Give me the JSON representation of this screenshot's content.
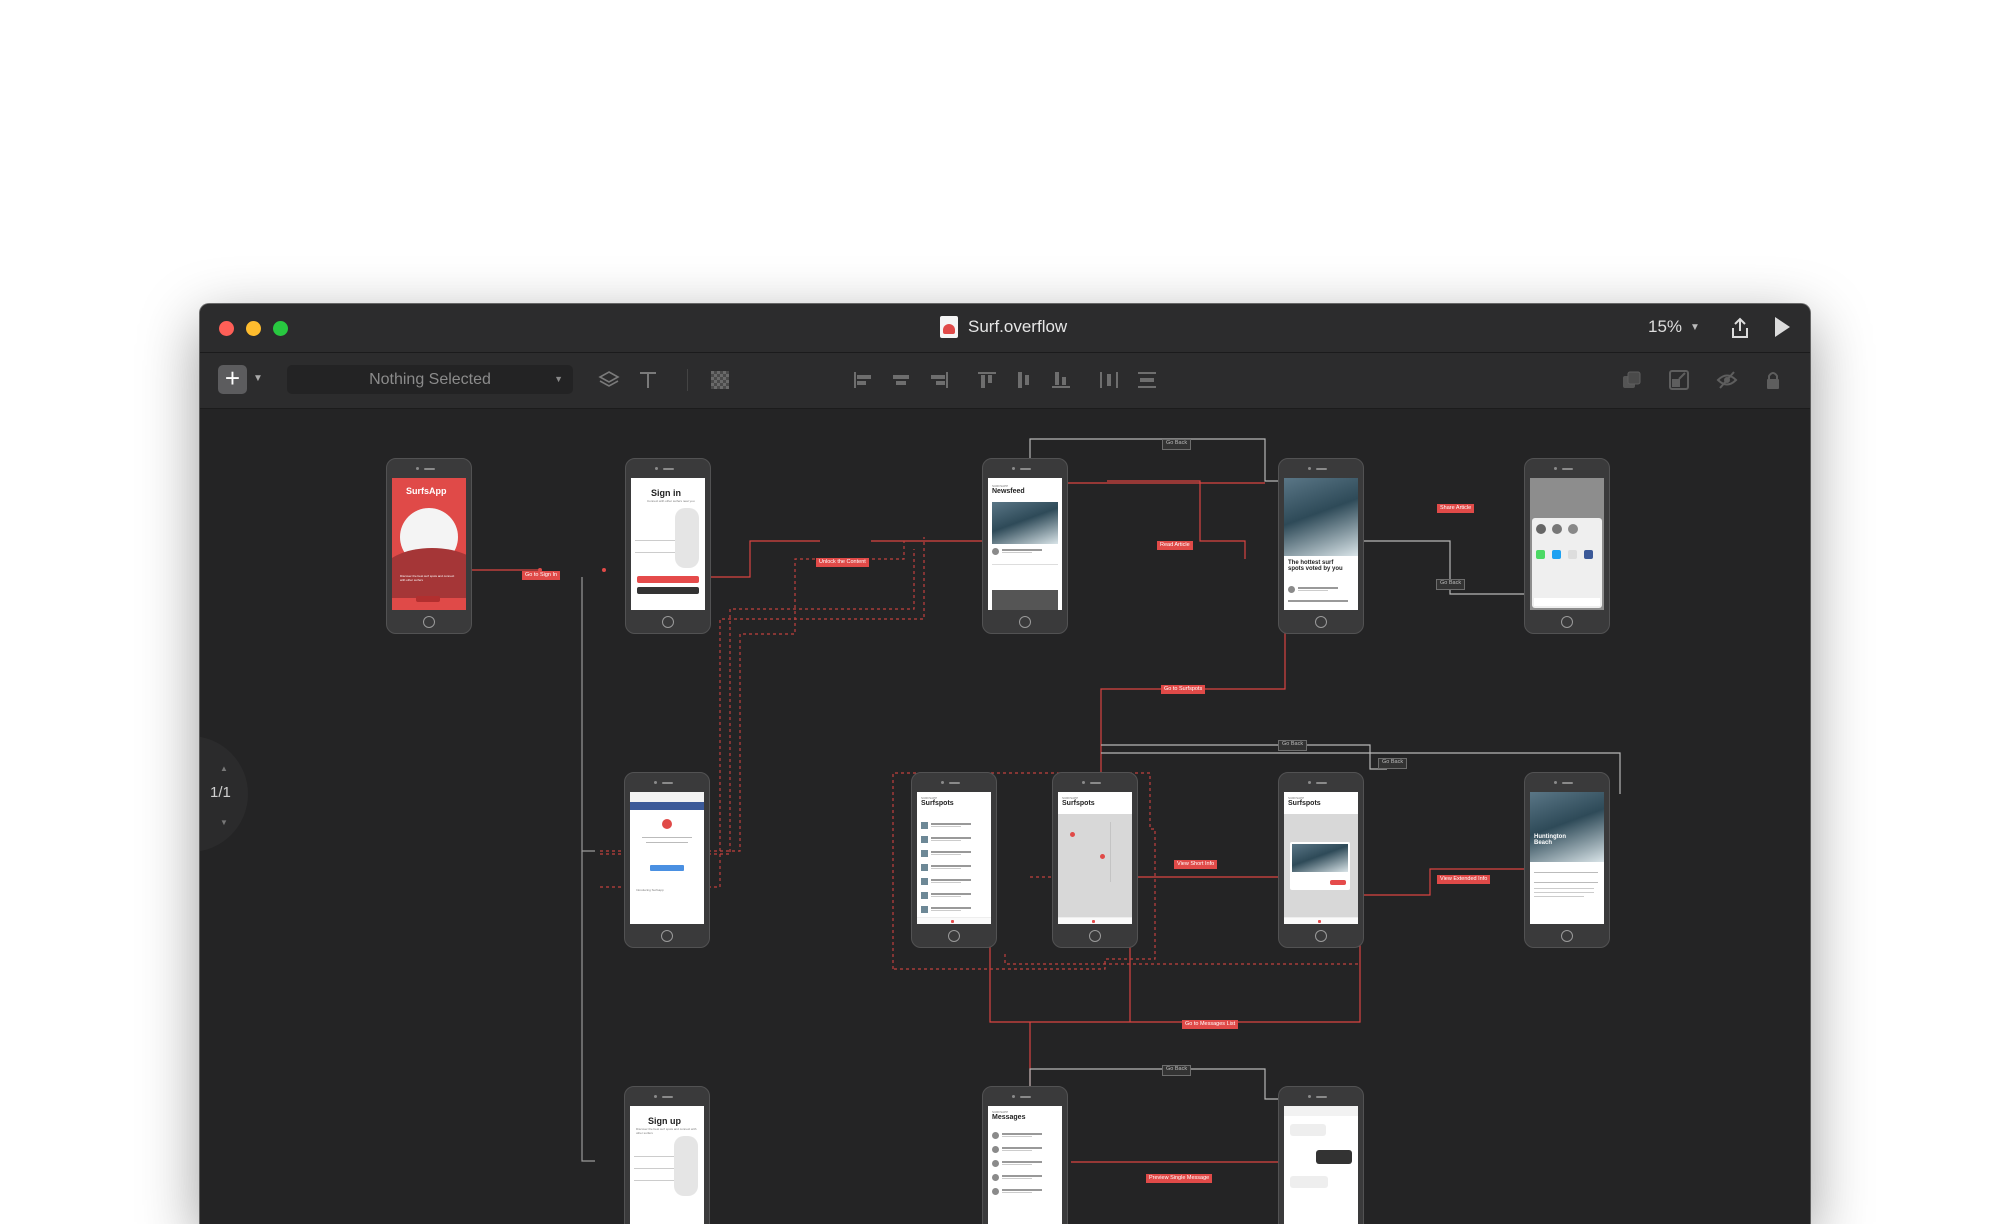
{
  "window": {
    "title": "Surf.overflow",
    "zoom": "15%"
  },
  "toolbar": {
    "selection": "Nothing Selected"
  },
  "page_indicator": "1/1",
  "screens": {
    "splash": {
      "title": "SurfsApp",
      "text": "Discover the best surf spots and connect with other surfers"
    },
    "signin": {
      "title": "Sign in",
      "text": "Connect with other surfers near you"
    },
    "onboard": {
      "text": "Introducing Surfsapp"
    },
    "signup": {
      "title": "Sign up",
      "text": "Discover the best surf spots and connect with other surfers"
    },
    "newsfeed": {
      "title": "Newsfeed",
      "section": "SURFSAPP"
    },
    "article": {
      "title": "The hottest surf spots voted by you"
    },
    "surfspots_list": {
      "title": "Surfspots",
      "section": "SURFSAPP"
    },
    "surfspots_map": {
      "title": "Surfspots",
      "section": "SURFSAPP"
    },
    "surfspots_card": {
      "title": "Surfspots",
      "section": "SURFSAPP"
    },
    "detail": {
      "title": "Huntington Beach"
    },
    "messages": {
      "title": "Messages",
      "section": "SURFSAPP"
    }
  },
  "flow_labels": {
    "go_to_signin": "Go to Sign In",
    "unlock_content": "Unlock the Content",
    "read_article": "Read Article",
    "share_article": "Share Article",
    "go_back_1": "Go Back",
    "go_back_2": "Go Back",
    "go_to_surfspots": "Go to Surfspots",
    "go_back_3": "Go Back",
    "go_back_4": "Go Back",
    "view_short_info": "View Short Info",
    "view_extended_info": "View Extended Info",
    "go_to_messages": "Go to Messages List",
    "go_back_5": "Go Back",
    "preview_message": "Preview Single Message"
  }
}
